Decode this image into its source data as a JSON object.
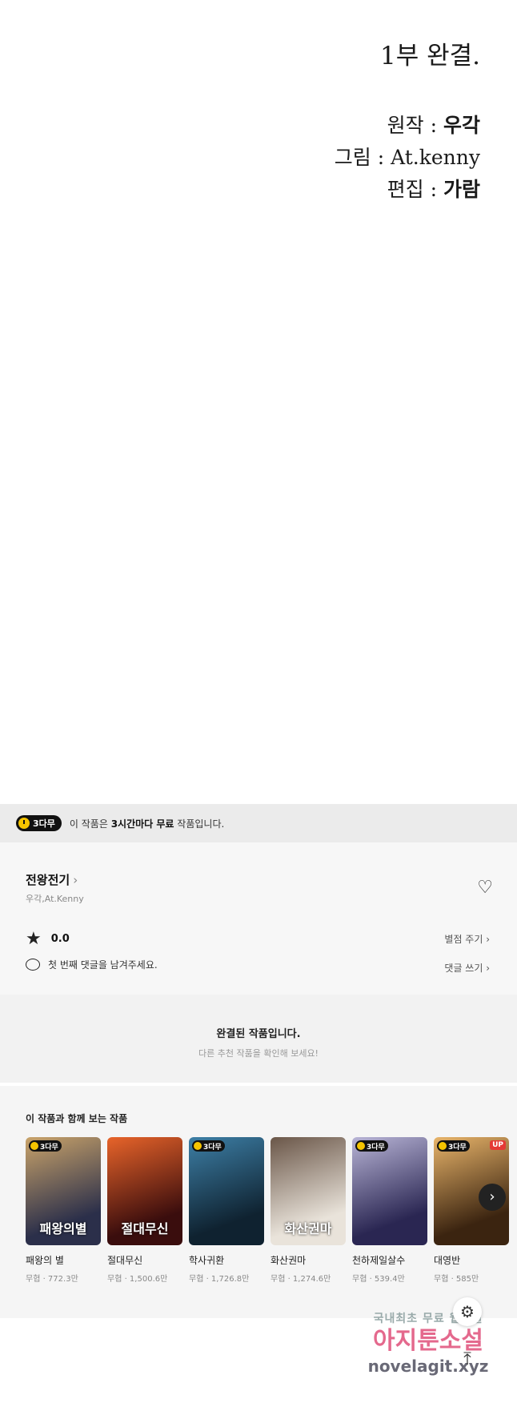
{
  "credits": {
    "title": "1부 완결.",
    "lines": [
      {
        "label": "원작 : ",
        "value": "우각"
      },
      {
        "label": "그림 : ",
        "value": "At.kenny"
      },
      {
        "label": "편집 : ",
        "value": "가람"
      }
    ]
  },
  "free_bar": {
    "badge": "3다무",
    "text_prefix": "이 작품은 ",
    "text_bold": "3시간마다 무료",
    "text_suffix": " 작품입니다."
  },
  "work": {
    "title": "전왕전기",
    "title_chevron": "›",
    "authors": "우각,At.Kenny",
    "rating": "0.0",
    "rate_link": "별점 주기 ›",
    "comment_prompt": "첫 번째 댓글을 남겨주세요.",
    "comment_link": "댓글 쓰기 ›"
  },
  "completed": {
    "title": "완결된 작품입니다.",
    "subtitle": "다른 추천 작품을 확인해 보세요!"
  },
  "recommend": {
    "heading": "이 작품과 함께 보는 작품",
    "items": [
      {
        "name": "패왕의 별",
        "meta": "무협 · 772.3만",
        "cover_text": "패왕의별",
        "badge": "3다무",
        "up": "",
        "c1": "#2b2f4a",
        "c2": "#c9a36a"
      },
      {
        "name": "절대무신",
        "meta": "무협 · 1,500.6만",
        "cover_text": "절대무신",
        "badge": "",
        "up": "",
        "c1": "#3a0d0d",
        "c2": "#e8642a"
      },
      {
        "name": "학사귀환",
        "meta": "무협 · 1,726.8만",
        "cover_text": "",
        "badge": "3다무",
        "up": "",
        "c1": "#0f2230",
        "c2": "#3d7fa6"
      },
      {
        "name": "화산권마",
        "meta": "무협 · 1,274.6만",
        "cover_text": "화산권마",
        "badge": "",
        "up": "",
        "c1": "#e9e3da",
        "c2": "#6a5648"
      },
      {
        "name": "천하제일살수",
        "meta": "무협 · 539.4만",
        "cover_text": "",
        "badge": "3다무",
        "up": "",
        "c1": "#2a2652",
        "c2": "#b8b4d6"
      },
      {
        "name": "대영반",
        "meta": "무협 · 585만",
        "cover_text": "",
        "badge": "3다무",
        "up": "UP",
        "c1": "#3b2410",
        "c2": "#e8b46a"
      }
    ],
    "next_icon": "›"
  },
  "controls": {
    "gear_icon": "⚙",
    "top_icon": "⤒"
  },
  "watermark": {
    "line1": "국내최초 무료 웹소설",
    "line2": "아지툰소설",
    "line3": "novelagit.xyz"
  }
}
